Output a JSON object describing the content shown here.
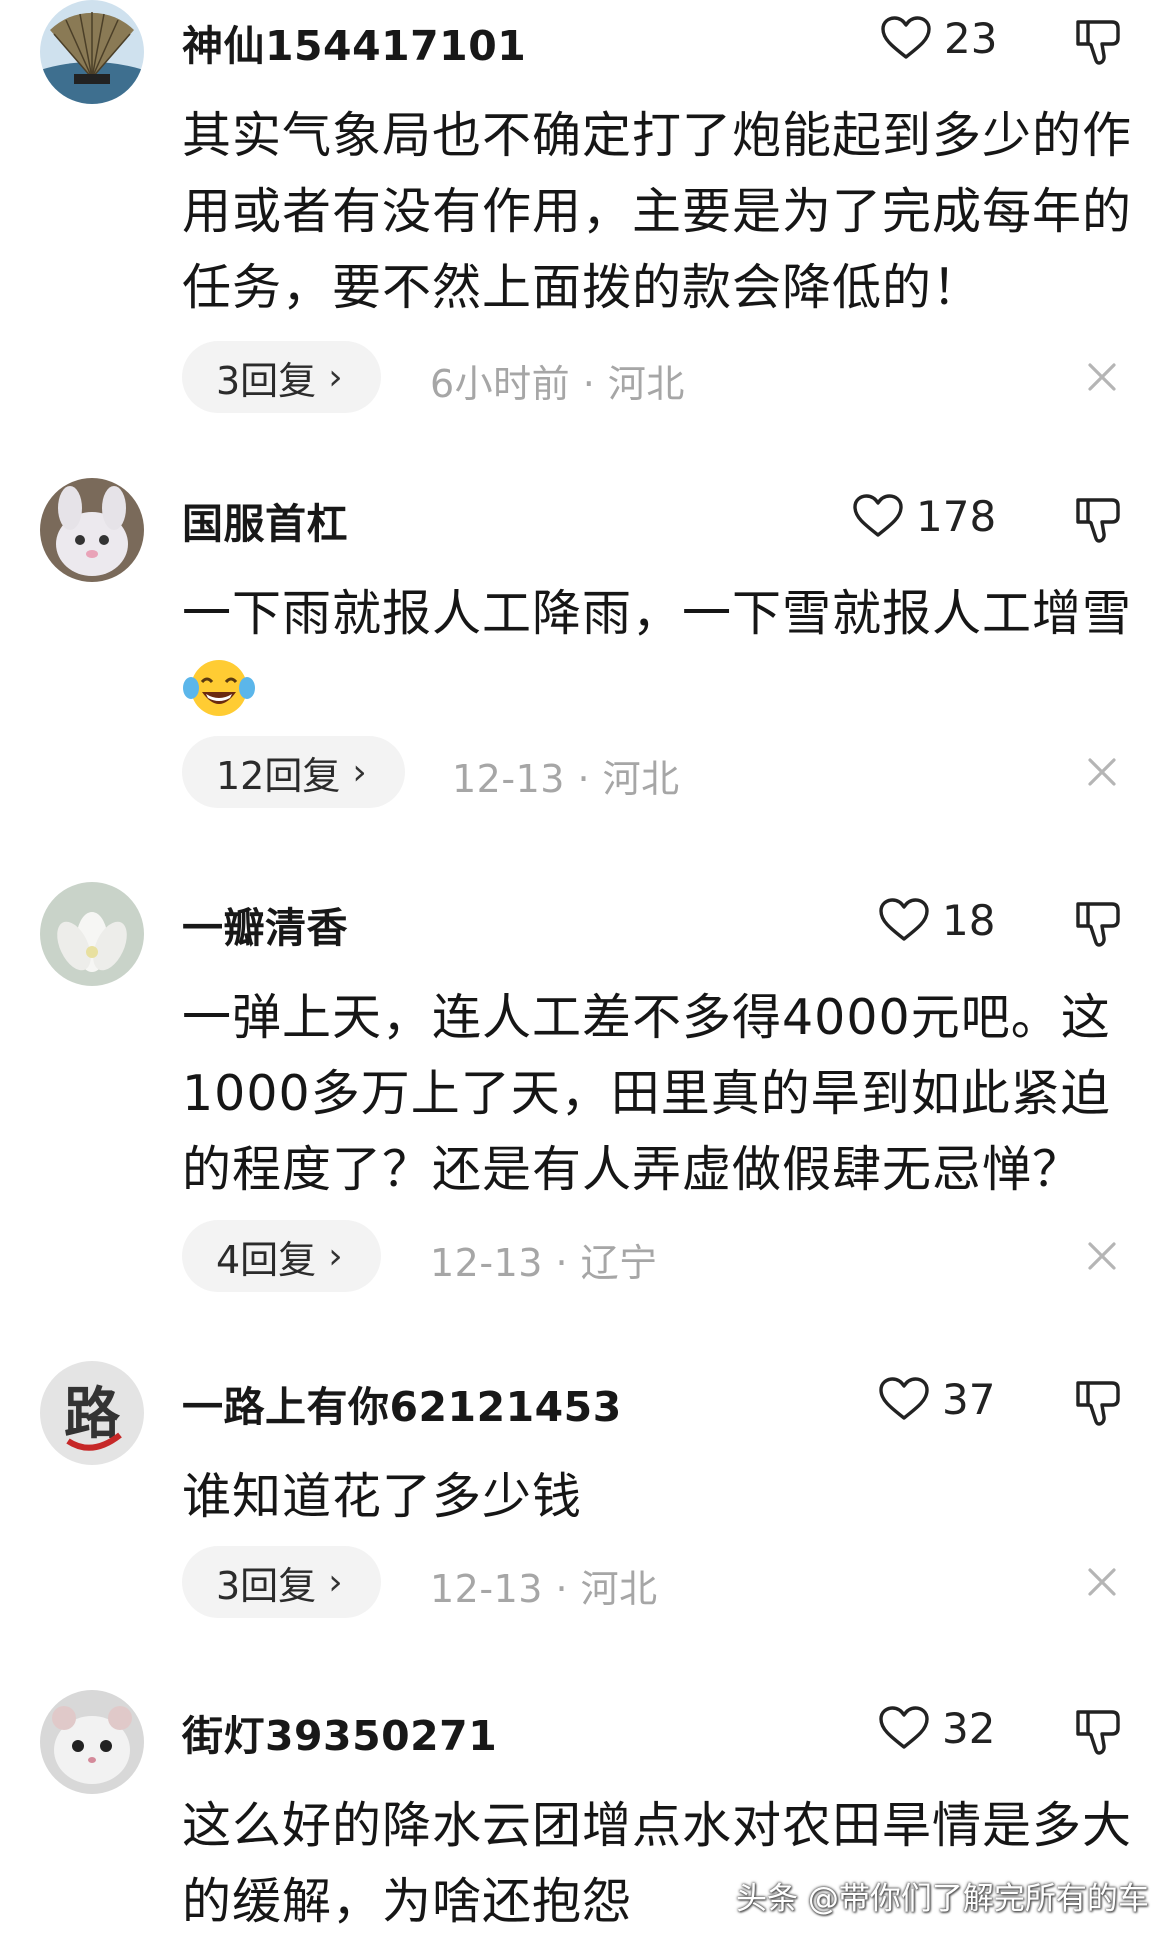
{
  "comments": [
    {
      "username": "神仙154417101",
      "likes": "23",
      "content": "其实气象局也不确定打了炮能起到多少的作用或者有没有作用，主要是为了完成每年的任务，要不然上面拨的款会降低的！",
      "replies": "3回复",
      "meta": "6小时前 · 河北",
      "avatar_icon": "fan-avatar-icon"
    },
    {
      "username": "国服首杠",
      "likes": "178",
      "content": "一下雨就报人工降雨，一下雪就报人工增雪",
      "emoji": "laughing-tears-emoji",
      "replies": "12回复",
      "meta": "12-13 · 河北",
      "avatar_icon": "bunny-avatar-icon"
    },
    {
      "username": "一瓣清香",
      "likes": "18",
      "content": "一弹上天，连人工差不多得4000元吧。这1000多万上了天，田里真的旱到如此紧迫的程度了？还是有人弄虚做假肆无忌惮？",
      "replies": "4回复",
      "meta": "12-13 · 辽宁",
      "avatar_icon": "lotus-avatar-icon"
    },
    {
      "username": "一路上有你62121453",
      "likes": "37",
      "content": "谁知道花了多少钱",
      "replies": "3回复",
      "meta": "12-13 · 河北",
      "avatar_icon": "lu-character-avatar-icon"
    },
    {
      "username": "街灯39350271",
      "likes": "32",
      "content": "这么好的降水云团增点水对农田旱情是多大的缓解，为啥还抱怨",
      "avatar_icon": "hamster-avatar-icon"
    }
  ],
  "watermark": "头条 @带你们了解完所有的车",
  "colors": {
    "text": "#161616",
    "meta": "#a6a6a6",
    "pill_bg": "#f3f3f3"
  }
}
